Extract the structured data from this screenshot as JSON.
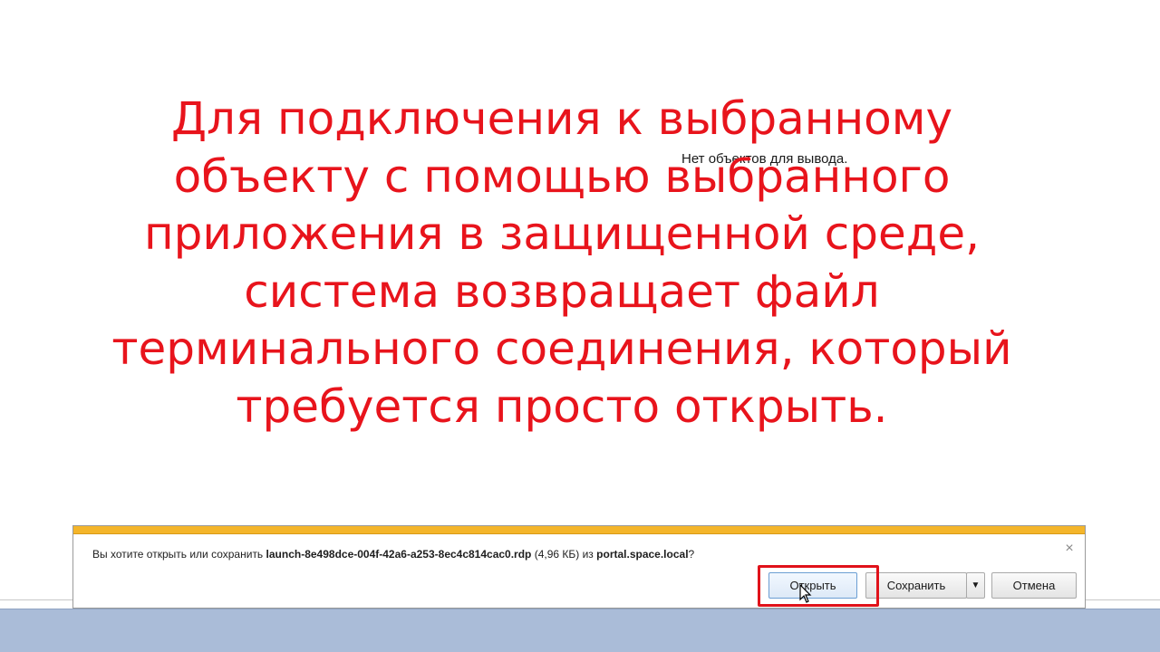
{
  "page": {
    "empty_message": "Нет объектов для вывода."
  },
  "overlay": {
    "lines": [
      "Для подключения к выбранному",
      "объекту с помощью выбранного",
      "приложения в защищенной среде,",
      "система возвращает файл",
      "терминального соединения, который",
      "требуется просто открыть."
    ],
    "color": "#e8141c"
  },
  "download_bar": {
    "prefix": "Вы хотите открыть или сохранить ",
    "filename": "launch-8e498dce-004f-42a6-a253-8ec4c814cac0.rdp",
    "size": " (4,96 КБ) из ",
    "source": "portal.space.local",
    "suffix": "?",
    "close_symbol": "×",
    "buttons": {
      "open": "Открыть",
      "save": "Сохранить",
      "save_menu": "▼",
      "cancel": "Отмена"
    },
    "accent_color": "#f4b52a",
    "highlight_color": "#e0121a"
  },
  "icons": {
    "close": "close-icon",
    "cursor": "mouse-cursor-icon",
    "dropdown": "chevron-down-icon"
  }
}
